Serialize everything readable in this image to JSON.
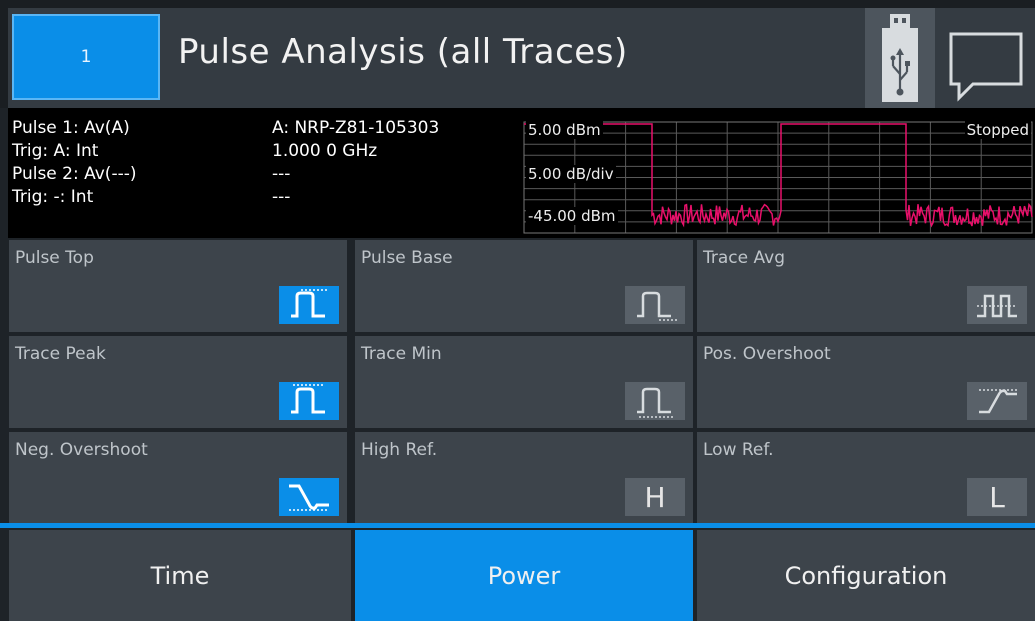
{
  "header": {
    "channel": "1",
    "title": "Pulse Analysis (all Traces)"
  },
  "info": {
    "pulse1": "Pulse 1: Av(A)",
    "trig1": "Trig: A: Int",
    "pulse2": "Pulse 2: Av(---)",
    "trig2": "Trig: -: Int",
    "sensor": "A: NRP-Z81-105303",
    "freq": "1.000 0 GHz",
    "sensor2": "---",
    "freq2": "---"
  },
  "trace": {
    "top_level": "5.00 dBm",
    "scale": "5.00 dB/div",
    "bottom_level": "-45.00 dBm",
    "status": "Stopped",
    "color": "#e8106a"
  },
  "tiles": [
    {
      "label": "Pulse Top",
      "icon": "pulse-top-icon",
      "active": true
    },
    {
      "label": "Pulse Base",
      "icon": "pulse-base-icon",
      "active": false
    },
    {
      "label": "Trace Avg",
      "icon": "trace-avg-icon",
      "active": false
    },
    {
      "label": "Trace Peak",
      "icon": "trace-peak-icon",
      "active": true
    },
    {
      "label": "Trace Min",
      "icon": "trace-min-icon",
      "active": false
    },
    {
      "label": "Pos. Overshoot",
      "icon": "pos-overshoot-icon",
      "active": false
    },
    {
      "label": "Neg. Overshoot",
      "icon": "neg-overshoot-icon",
      "active": true
    },
    {
      "label": "High Ref.",
      "icon": "high-ref-icon",
      "active": false,
      "letter": "H"
    },
    {
      "label": "Low Ref.",
      "icon": "low-ref-icon",
      "active": false,
      "letter": "L"
    }
  ],
  "tabs": [
    {
      "label": "Time",
      "active": false
    },
    {
      "label": "Power",
      "active": true
    },
    {
      "label": "Configuration",
      "active": false
    }
  ],
  "colors": {
    "accent": "#0a8ee8",
    "tile_bg": "#3d444b",
    "icon_bg": "#596169"
  }
}
